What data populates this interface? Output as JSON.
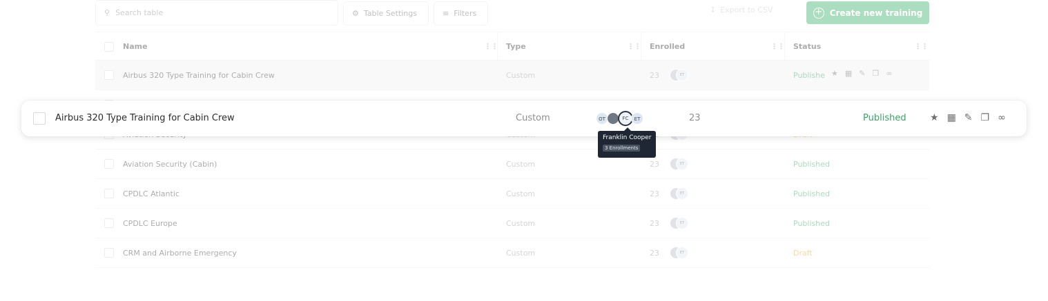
{
  "toolbar": {
    "search_placeholder": "Search table",
    "table_settings_label": "Table Settings",
    "filters_label": "Filters",
    "export_label": "Export to CSV",
    "create_label": "Create new training"
  },
  "table": {
    "columns": [
      "Name",
      "Type",
      "Enrolled",
      "Status"
    ],
    "rows": [
      {
        "name": "Airbus 320 Type Training for Cabin Crew",
        "type": "Custom",
        "enrolled": "23",
        "avatar": "ET",
        "status": "Publishe",
        "status_kind": "published"
      },
      {
        "name": "",
        "type": "",
        "enrolled": "",
        "avatar": "",
        "status": "",
        "status_kind": "published"
      },
      {
        "name": "Aviation Security",
        "type": "Custom",
        "enrolled": "23",
        "avatar": "ET",
        "status": "Draft",
        "status_kind": "draft"
      },
      {
        "name": "Aviation Security (Cabin)",
        "type": "Custom",
        "enrolled": "23",
        "avatar": "ET",
        "status": "Published",
        "status_kind": "published"
      },
      {
        "name": "CPDLC Atlantic",
        "type": "Custom",
        "enrolled": "23",
        "avatar": "ET",
        "status": "Published",
        "status_kind": "published"
      },
      {
        "name": "CPDLC Europe",
        "type": "Custom",
        "enrolled": "23",
        "avatar": "ET",
        "status": "Published",
        "status_kind": "published"
      },
      {
        "name": "CRM and Airborne Emergency",
        "type": "Custom",
        "enrolled": "23",
        "avatar": "ET",
        "status": "Draft",
        "status_kind": "draft"
      }
    ]
  },
  "highlight_row": {
    "name": "Airbus 320 Type Training for Cabin Crew",
    "type": "Custom",
    "avatars": [
      "OT",
      "",
      "FC",
      "ET"
    ],
    "enrolled": "23",
    "status": "Published"
  },
  "tooltip": {
    "name": "Franklin Cooper",
    "count": "3 Enrollments"
  },
  "colors": {
    "primary_green": "#3aaf6b",
    "published": "#3aa566",
    "draft": "#f0a62a",
    "tooltip_bg": "#1e2733"
  }
}
